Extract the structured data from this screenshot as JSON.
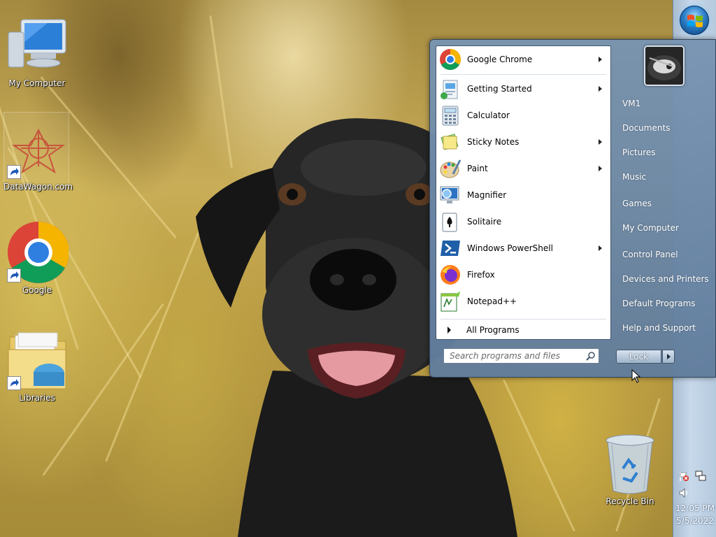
{
  "desktop": {
    "icons": [
      {
        "label": "My Computer",
        "icon": "computer-icon"
      },
      {
        "label": "DataWagon.com",
        "icon": "datawagon-icon"
      },
      {
        "label": "Google",
        "icon": "chrome-icon"
      },
      {
        "label": "Libraries",
        "icon": "libraries-folder-icon"
      },
      {
        "label": "Recycle Bin",
        "icon": "recycle-bin-icon"
      }
    ]
  },
  "start_menu": {
    "programs": [
      {
        "label": "Google Chrome",
        "icon": "chrome-icon",
        "submenu": true
      },
      {
        "label": "Getting Started",
        "icon": "getting-started-icon",
        "submenu": true
      },
      {
        "label": "Calculator",
        "icon": "calculator-icon",
        "submenu": false
      },
      {
        "label": "Sticky Notes",
        "icon": "sticky-notes-icon",
        "submenu": true
      },
      {
        "label": "Paint",
        "icon": "paint-icon",
        "submenu": true
      },
      {
        "label": "Magnifier",
        "icon": "magnifier-icon",
        "submenu": false
      },
      {
        "label": "Solitaire",
        "icon": "solitaire-icon",
        "submenu": false
      },
      {
        "label": "Windows PowerShell",
        "icon": "powershell-icon",
        "submenu": true
      },
      {
        "label": "Firefox",
        "icon": "firefox-icon",
        "submenu": false
      },
      {
        "label": "Notepad++",
        "icon": "notepad-plus-plus-icon",
        "submenu": false
      }
    ],
    "all_programs_label": "All Programs",
    "search_placeholder": "Search programs and files",
    "right_links": [
      "VM1",
      "Documents",
      "Pictures",
      "Music",
      "Games",
      "My Computer",
      "Control Panel",
      "Devices and Printers",
      "Default Programs",
      "Help and Support"
    ],
    "lock_label": "Lock"
  },
  "taskbar": {
    "clock_time": "12:05 PM",
    "clock_date": "5/5/2022",
    "tray_icons": [
      "action-center-flag-icon",
      "network-icon",
      "volume-icon"
    ]
  },
  "colors": {
    "start_menu_bg": "#7894b2",
    "taskbar_bg": "#c7d8ea",
    "accent": "#2b7fc8"
  }
}
